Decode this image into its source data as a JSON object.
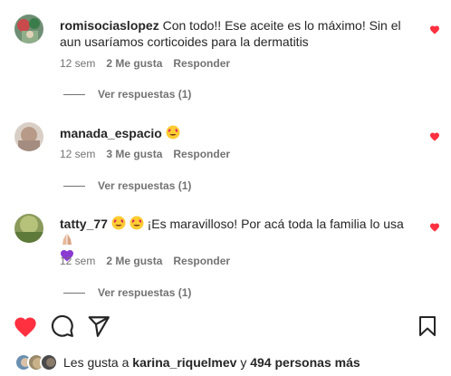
{
  "comments": [
    {
      "username": "romisociaslopez",
      "text": "Con todo!! Ese aceite es lo máximo! Sin el aun usaríamos corticoides para la dermatitis",
      "time": "12 sem",
      "likes": "2 Me gusta",
      "reply": "Responder",
      "view_replies": "Ver respuestas (1)",
      "liked": true
    },
    {
      "username": "manada_espacio",
      "text": "",
      "time": "12 sem",
      "likes": "3 Me gusta",
      "reply": "Responder",
      "view_replies": "Ver respuestas (1)",
      "liked": true
    },
    {
      "username": "tatty_77",
      "text": "¡Es maravilloso! Por acá toda la familia lo usa",
      "time": "12 sem",
      "likes": "2 Me gusta",
      "reply": "Responder",
      "view_replies": "Ver respuestas (1)",
      "liked": true
    }
  ],
  "likes_summary": {
    "prefix": "Les gusta a",
    "user": "karina_riquelmev",
    "joiner": "y",
    "others": "494 personas más"
  },
  "colors": {
    "heart_red": "#ff3040",
    "muted": "#737373",
    "text": "#262626"
  },
  "icons": [
    "heart-icon",
    "comment-icon",
    "share-icon",
    "bookmark-icon",
    "heart-eyes-emoji",
    "purple-heart-emoji",
    "praying-hands-emoji"
  ]
}
